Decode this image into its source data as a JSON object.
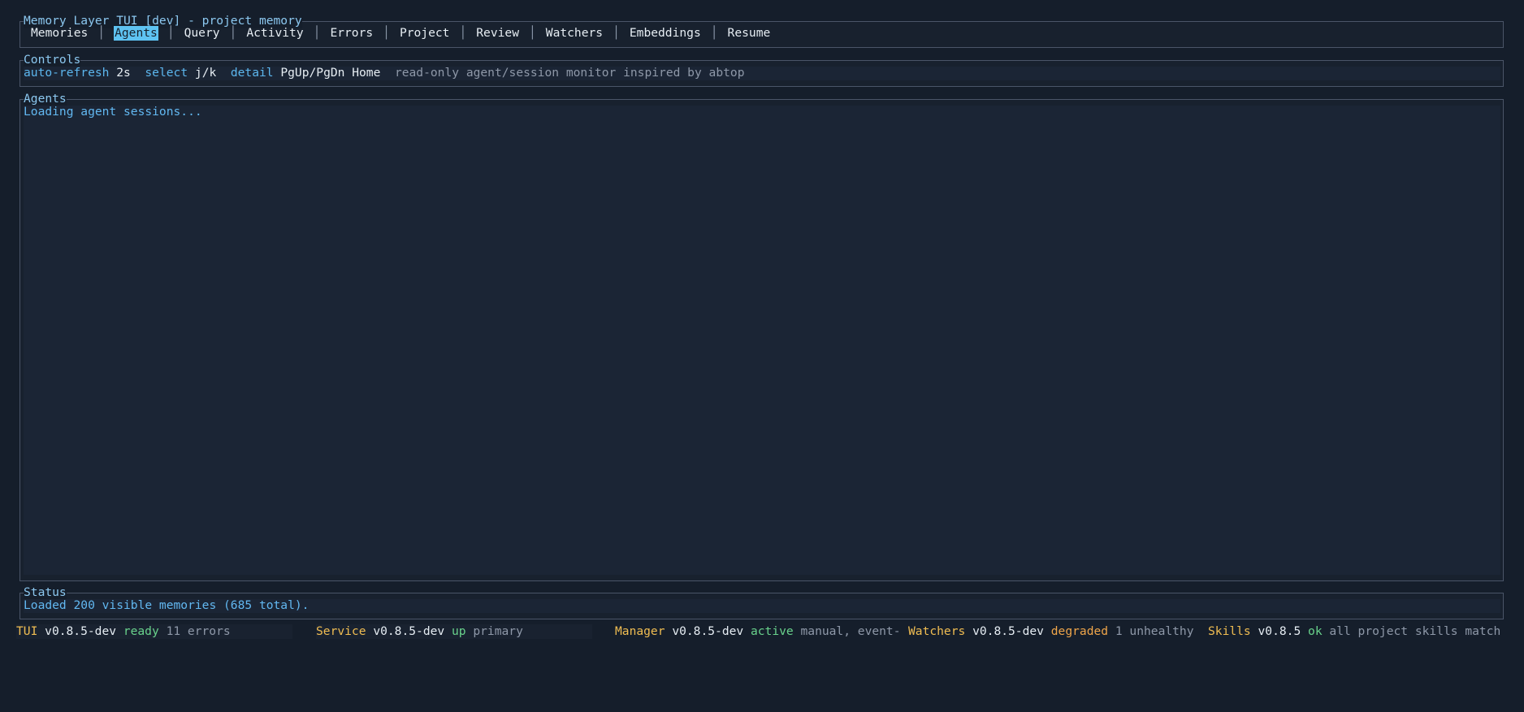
{
  "app": {
    "title": "Memory Layer TUI [dev] - project memory"
  },
  "tabs": [
    {
      "label": "Memories",
      "active": false
    },
    {
      "label": "Agents",
      "active": true
    },
    {
      "label": "Query",
      "active": false
    },
    {
      "label": "Activity",
      "active": false
    },
    {
      "label": "Errors",
      "active": false
    },
    {
      "label": "Project",
      "active": false
    },
    {
      "label": "Review",
      "active": false
    },
    {
      "label": "Watchers",
      "active": false
    },
    {
      "label": "Embeddings",
      "active": false
    },
    {
      "label": "Resume",
      "active": false
    }
  ],
  "tab_separator": "│",
  "controls": {
    "title": "Controls",
    "auto_refresh_key": "auto-refresh",
    "auto_refresh_val": "2s",
    "select_key": "select",
    "select_val": "j/k",
    "detail_key": "detail",
    "detail_val": "PgUp/PgDn Home",
    "description": "read-only agent/session monitor inspired by abtop"
  },
  "agents": {
    "title": "Agents",
    "loading_text": "Loading agent sessions..."
  },
  "status": {
    "title": "Status",
    "message": "Loaded 200 visible memories (685 total)."
  },
  "statusbar": {
    "tui": {
      "name": "TUI",
      "version": "v0.8.5-dev",
      "state": "ready",
      "detail": "11 errors"
    },
    "service": {
      "name": "Service",
      "version": "v0.8.5-dev",
      "state": "up",
      "detail": "primary"
    },
    "manager": {
      "name": "Manager",
      "version": "v0.8.5-dev",
      "state": "active",
      "detail": "manual, event-"
    },
    "watchers": {
      "name": "Watchers",
      "version": "v0.8.5-dev",
      "state": "degraded",
      "detail": "1 unhealthy"
    },
    "skills": {
      "name": "Skills",
      "version": "v0.8.5",
      "state": "ok",
      "detail": "all project skills match"
    }
  },
  "colors": {
    "accent": "#5ec3f2",
    "ok": "#69d28c",
    "warn": "#f0a64a",
    "label": "#f0bd52"
  }
}
